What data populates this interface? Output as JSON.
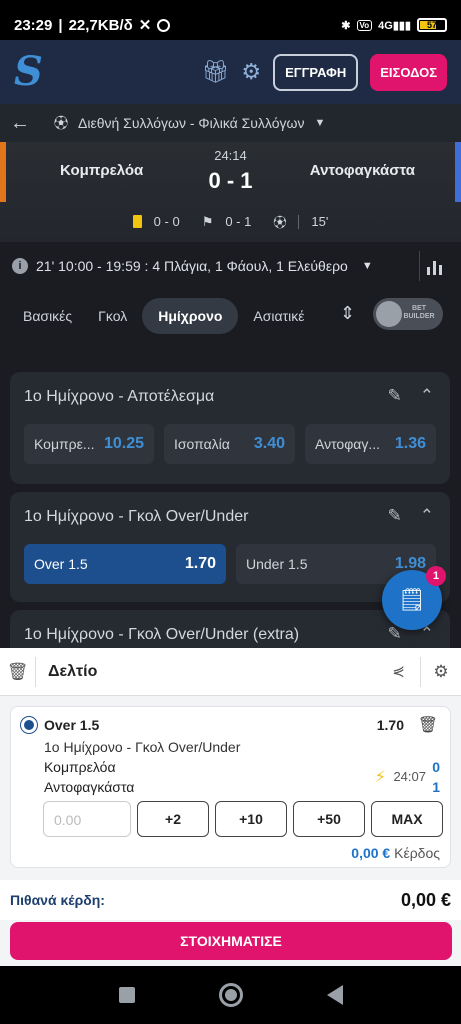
{
  "status_bar": {
    "time": "23:29",
    "speed": "22,7KB/δ",
    "battery": "57"
  },
  "header": {
    "logo": "S",
    "register": "ΕΓΓΡΑΦΗ",
    "login": "ΕΙΣΟΔΟΣ"
  },
  "breadcrumb": {
    "label": "Διεθνή Συλλόγων - Φιλικά Συλλόγων"
  },
  "match": {
    "home": "Κομπρελόα",
    "away": "Αντοφαγκάστα",
    "clock": "24:14",
    "score": "0 - 1",
    "cards": "0 - 0",
    "corners": "0 - 1",
    "minute": "15'"
  },
  "info": {
    "text": "21'  10:00 - 19:59 : 4 Πλάγια, 1 Φάουλ, 1 Ελεύθερο"
  },
  "tabs": [
    "Βασικές",
    "Γκολ",
    "Ημίχρονο",
    "Ασιατικέ"
  ],
  "bet_builder": "BET BUILDER",
  "markets": [
    {
      "title": "1ο Ημίχρονο - Αποτέλεσμα",
      "odds": [
        {
          "label": "Κομπρε...",
          "price": "10.25"
        },
        {
          "label": "Ισοπαλία",
          "price": "3.40"
        },
        {
          "label": "Αντοφαγ...",
          "price": "1.36"
        }
      ]
    },
    {
      "title": "1ο Ημίχρονο - Γκολ Over/Under",
      "odds": [
        {
          "label": "Over 1.5",
          "price": "1.70"
        },
        {
          "label": "Under 1.5",
          "price": "1.98"
        }
      ]
    },
    {
      "title": "1ο Ημίχρονο - Γκολ Over/Under (extra)"
    }
  ],
  "fab_badge": "1",
  "slip": {
    "title": "Δελτίο",
    "selection": "Over 1.5",
    "odd": "1.70",
    "market": "1ο Ημίχρονο - Γκολ Over/Under",
    "team1": "Κομπρελόα",
    "team2": "Αντοφαγκάστα",
    "time": "24:07",
    "score1": "0",
    "score2": "1",
    "stake_placeholder": "0.00",
    "chips": [
      "+2",
      "+10",
      "+50",
      "MAX"
    ],
    "profit_value": "0,00 €",
    "profit_label": "Κέρδος",
    "potential_label": "Πιθανά κέρδη:",
    "potential_value": "0,00 €",
    "place_bet": "ΣΤΟΙΧΗΜΑΤΙΣΕ"
  }
}
